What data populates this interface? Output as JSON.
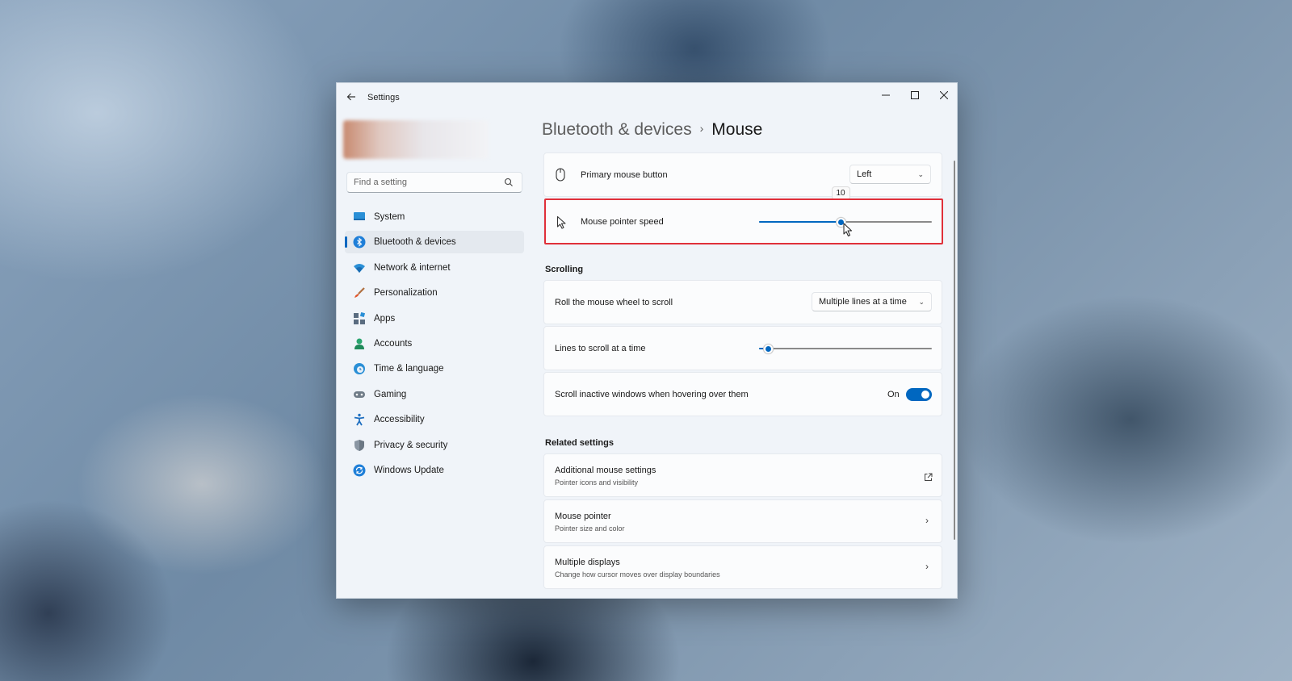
{
  "window": {
    "title": "Settings",
    "back_icon": "back-arrow-icon",
    "min_glyph": "—",
    "max_glyph": "☐",
    "close_glyph": "✕"
  },
  "search": {
    "placeholder": "Find a setting",
    "icon": "search-icon"
  },
  "sidebar": {
    "items": [
      {
        "label": "System",
        "icon": "monitor-icon",
        "active": false
      },
      {
        "label": "Bluetooth & devices",
        "icon": "bluetooth-icon",
        "active": true
      },
      {
        "label": "Network & internet",
        "icon": "wifi-icon",
        "active": false
      },
      {
        "label": "Personalization",
        "icon": "brush-icon",
        "active": false
      },
      {
        "label": "Apps",
        "icon": "apps-icon",
        "active": false
      },
      {
        "label": "Accounts",
        "icon": "person-icon",
        "active": false
      },
      {
        "label": "Time & language",
        "icon": "globe-clock-icon",
        "active": false
      },
      {
        "label": "Gaming",
        "icon": "gamepad-icon",
        "active": false
      },
      {
        "label": "Accessibility",
        "icon": "accessibility-icon",
        "active": false
      },
      {
        "label": "Privacy & security",
        "icon": "shield-icon",
        "active": false
      },
      {
        "label": "Windows Update",
        "icon": "update-icon",
        "active": false
      }
    ]
  },
  "header": {
    "parent": "Bluetooth & devices",
    "separator": "›",
    "current": "Mouse"
  },
  "primary_button": {
    "label": "Primary mouse button",
    "icon": "mouse-icon",
    "value": "Left",
    "chevron": "⌄"
  },
  "pointer_speed": {
    "label": "Mouse pointer speed",
    "icon": "cursor-icon",
    "value": 10,
    "tooltip": "10",
    "fraction": 0.47
  },
  "scrolling": {
    "title": "Scrolling",
    "roll_label": "Roll the mouse wheel to scroll",
    "roll_value": "Multiple lines at a time",
    "roll_chevron": "⌄",
    "lines_label": "Lines to scroll at a time",
    "lines_fraction": 0.05,
    "inactive_label": "Scroll inactive windows when hovering over them",
    "inactive_state": "On"
  },
  "related": {
    "title": "Related settings",
    "items": [
      {
        "label": "Additional mouse settings",
        "sub": "Pointer icons and visibility",
        "icon": "external-link-icon",
        "glyph": "↗"
      },
      {
        "label": "Mouse pointer",
        "sub": "Pointer size and color",
        "icon": "chevron-right-icon",
        "glyph": "›"
      },
      {
        "label": "Multiple displays",
        "sub": "Change how cursor moves over display boundaries",
        "icon": "chevron-right-icon",
        "glyph": "›"
      }
    ]
  },
  "colors": {
    "accent": "#0067c0",
    "highlight": "#e0303a"
  }
}
